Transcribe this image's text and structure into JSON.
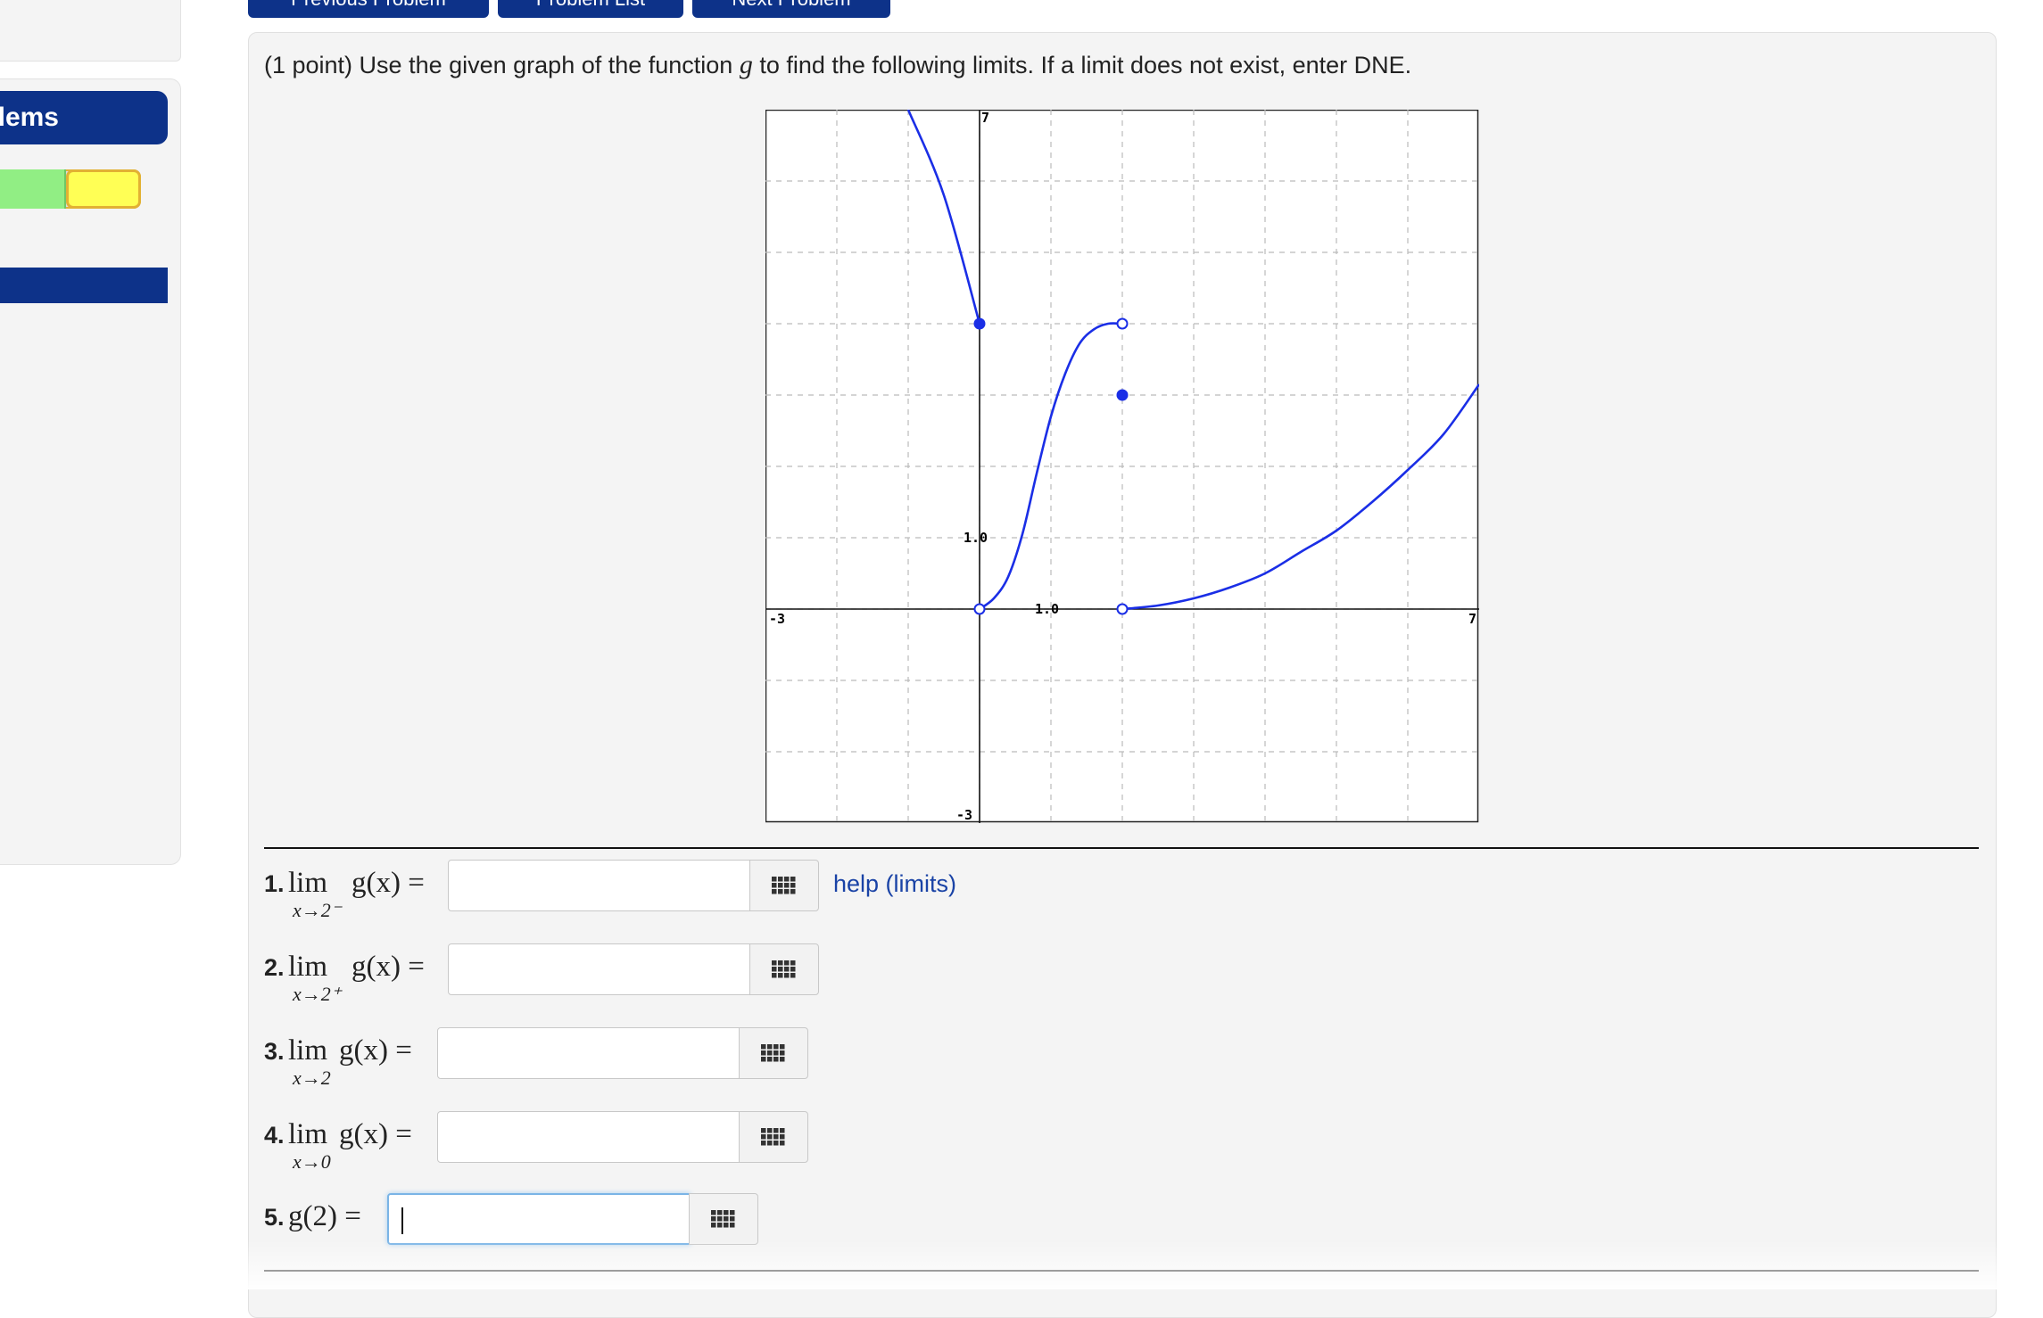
{
  "sidebar": {
    "problems_button_label": "Problems"
  },
  "nav": {
    "previous_label": "Previous Problem",
    "list_label": "Problem List",
    "next_label": "Next Problem"
  },
  "problem": {
    "statement_before": "(1 point) Use the given graph of the function ",
    "function_symbol": "g",
    "statement_after": " to find the following limits. If a limit does not exist, enter DNE."
  },
  "graph": {
    "x_range": [
      -3,
      7
    ],
    "y_range": [
      -3,
      7
    ],
    "grid": true,
    "labels": {
      "x_min": "-3",
      "x_max": "7",
      "y_min": "-3",
      "y_max": "7",
      "x_unit": "1.0",
      "y_unit": "1.0"
    },
    "segments": [
      {
        "points": [
          [
            -1,
            7
          ],
          [
            -0.5,
            5.8
          ],
          [
            0,
            4
          ]
        ],
        "left_end": "none",
        "right_end": "closed"
      },
      {
        "points": [
          [
            0,
            0
          ],
          [
            0.2,
            0.15
          ],
          [
            0.4,
            0.45
          ],
          [
            0.6,
            1.05
          ],
          [
            0.8,
            1.9
          ],
          [
            1.0,
            2.7
          ],
          [
            1.2,
            3.3
          ],
          [
            1.4,
            3.72
          ],
          [
            1.6,
            3.92
          ],
          [
            1.8,
            4.0
          ],
          [
            2,
            4
          ]
        ],
        "left_end": "open",
        "right_end": "open"
      },
      {
        "points": [
          [
            2,
            0
          ],
          [
            2.5,
            0.05
          ],
          [
            3,
            0.15
          ],
          [
            3.5,
            0.3
          ],
          [
            4,
            0.5
          ],
          [
            4.5,
            0.8
          ],
          [
            5,
            1.1
          ],
          [
            5.5,
            1.5
          ],
          [
            6,
            1.95
          ],
          [
            6.5,
            2.45
          ],
          [
            7,
            3.15
          ]
        ],
        "left_end": "open",
        "right_end": "none"
      }
    ],
    "isolated_points": [
      [
        2,
        3
      ]
    ],
    "curve_color": "#1a2ee6"
  },
  "answers": [
    {
      "num": "1.",
      "func": "lim",
      "expr": "g(x) =",
      "sub": "x→2⁻",
      "value": ""
    },
    {
      "num": "2.",
      "func": "lim",
      "expr": "g(x) =",
      "sub": "x→2⁺",
      "value": ""
    },
    {
      "num": "3.",
      "func": "lim",
      "expr": "g(x) =",
      "sub": "x→2",
      "value": ""
    },
    {
      "num": "4.",
      "func": "lim",
      "expr": "g(x) =",
      "sub": "x→0",
      "value": ""
    },
    {
      "num": "5.",
      "func": "",
      "expr": "g(2) =",
      "sub": "",
      "value": ""
    }
  ],
  "help_link": "help (limits)",
  "colors": {
    "brand": "#0d3289",
    "link": "#1a43a6"
  }
}
